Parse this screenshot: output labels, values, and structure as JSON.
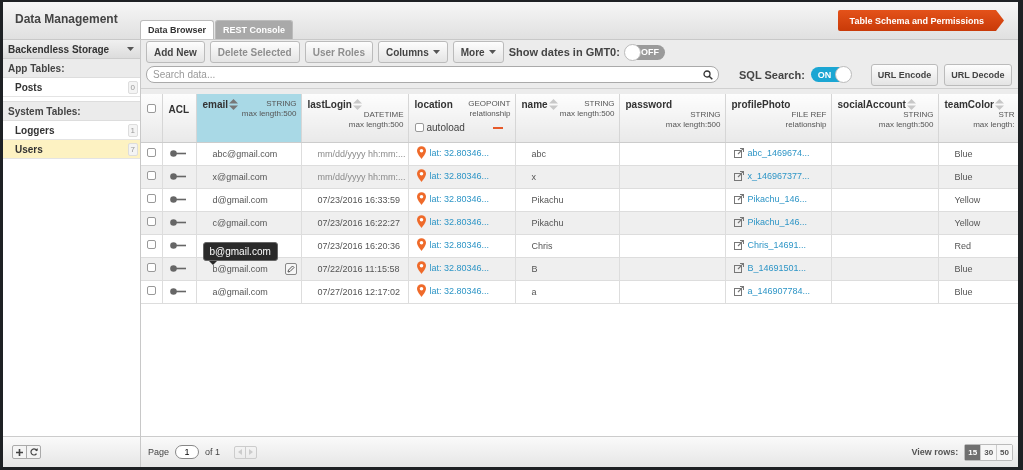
{
  "app": {
    "title": "Data Management"
  },
  "tabs": [
    {
      "label": "Data Browser",
      "selected": true
    },
    {
      "label": "REST Console",
      "selected": false
    }
  ],
  "schema_button": "Table Schema and Permissions",
  "sidebar": {
    "storage": "Backendless Storage",
    "groups": [
      {
        "title": "App Tables:",
        "items": [
          {
            "label": "Posts",
            "count": "0",
            "selected": false
          }
        ]
      },
      {
        "title": "System Tables:",
        "items": [
          {
            "label": "Loggers",
            "count": "1",
            "selected": false
          },
          {
            "label": "Users",
            "count": "7",
            "selected": true
          }
        ]
      }
    ]
  },
  "toolbar": {
    "buttons": [
      {
        "label": "Add New",
        "kind": "button",
        "disabled": false
      },
      {
        "label": "Delete Selected",
        "kind": "button",
        "disabled": true
      },
      {
        "label": "User Roles",
        "kind": "button",
        "disabled": true
      },
      {
        "label": "Columns",
        "kind": "dropdown",
        "disabled": false
      },
      {
        "label": "More",
        "kind": "dropdown",
        "disabled": false
      }
    ],
    "gmt_toggle": {
      "label": "Show dates in GMT0:",
      "on": false,
      "state_text": "OFF"
    }
  },
  "search": {
    "placeholder": "Search data...",
    "sql_toggle": {
      "label": "SQL Search:",
      "on": true,
      "state_text": "ON"
    },
    "buttons": [
      "URL Encode",
      "URL Decode"
    ]
  },
  "table": {
    "columns": [
      {
        "kind": "select",
        "checked": false
      },
      {
        "kind": "acl",
        "name": "ACL"
      },
      {
        "kind": "field",
        "name": "email",
        "type": "STRING",
        "detail": "max length:500",
        "sortable": true,
        "selected": true
      },
      {
        "kind": "field",
        "name": "lastLogin",
        "type": "DATETIME",
        "detail": "max length:500",
        "sortable": true,
        "selected": false
      },
      {
        "kind": "field",
        "name": "location",
        "type": "GEOPOINT",
        "detail": "relationship",
        "sortable": false,
        "selected": false,
        "autoload": {
          "label": "autoload",
          "checked": false
        }
      },
      {
        "kind": "field",
        "name": "name",
        "type": "STRING",
        "detail": "max length:500",
        "sortable": true,
        "selected": false
      },
      {
        "kind": "field",
        "name": "password",
        "type": "STRING",
        "detail": "max length:500",
        "sortable": false,
        "selected": false
      },
      {
        "kind": "field",
        "name": "profilePhoto",
        "type": "FILE REF",
        "detail": "relationship",
        "sortable": false,
        "selected": false
      },
      {
        "kind": "field",
        "name": "socialAccount",
        "type": "STRING",
        "detail": "max length:500",
        "sortable": true,
        "selected": false
      },
      {
        "kind": "field",
        "name": "teamColor",
        "type": "STR",
        "detail": "max length:",
        "sortable": true,
        "selected": false
      }
    ],
    "rows": [
      {
        "checked": false,
        "email": "abc@gmail.com",
        "last_login_placeholder": "mm/dd/yyyy hh:mm:...",
        "location": "lat: 32.80346...",
        "name": "abc",
        "profile_photo": "abc_1469674...",
        "team_color": "Blue",
        "hovered": false
      },
      {
        "checked": false,
        "email": "x@gmail.com",
        "last_login_placeholder": "mm/dd/yyyy hh:mm:...",
        "location": "lat: 32.80346...",
        "name": "x",
        "profile_photo": "x_146967377...",
        "team_color": "Blue",
        "hovered": false
      },
      {
        "checked": false,
        "email": "d@gmail.com",
        "last_login": "07/23/2016 16:33:59",
        "location": "lat: 32.80346...",
        "name": "Pikachu",
        "profile_photo": "Pikachu_146...",
        "team_color": "Yellow",
        "hovered": false
      },
      {
        "checked": false,
        "email": "c@gmail.com",
        "last_login": "07/23/2016 16:22:27",
        "location": "lat: 32.80346...",
        "name": "Pikachu",
        "profile_photo": "Pikachu_146...",
        "team_color": "Yellow",
        "hovered": false
      },
      {
        "checked": false,
        "last_login": "07/23/2016 16:20:36",
        "location": "lat: 32.80346...",
        "name": "Chris",
        "profile_photo": "Chris_14691...",
        "team_color": "Red",
        "hovered": false
      },
      {
        "checked": false,
        "email": "b@gmail.com",
        "tooltip": "b@gmail.com",
        "last_login": "07/22/2016 11:15:58",
        "location": "lat: 32.80346...",
        "name": "B",
        "profile_photo": "B_14691501...",
        "team_color": "Blue",
        "hovered": true
      },
      {
        "checked": false,
        "email": "a@gmail.com",
        "last_login": "07/27/2016 12:17:02",
        "location": "lat: 32.80346...",
        "name": "a",
        "profile_photo": "a_146907784...",
        "team_color": "Blue",
        "hovered": false
      }
    ]
  },
  "pagination": {
    "label": "Page",
    "page": "1",
    "total": "of 1"
  },
  "view_rows": {
    "label": "View rows:",
    "options": [
      {
        "label": "15",
        "selected": true
      },
      {
        "label": "30",
        "selected": false
      },
      {
        "label": "50",
        "selected": false
      }
    ]
  }
}
